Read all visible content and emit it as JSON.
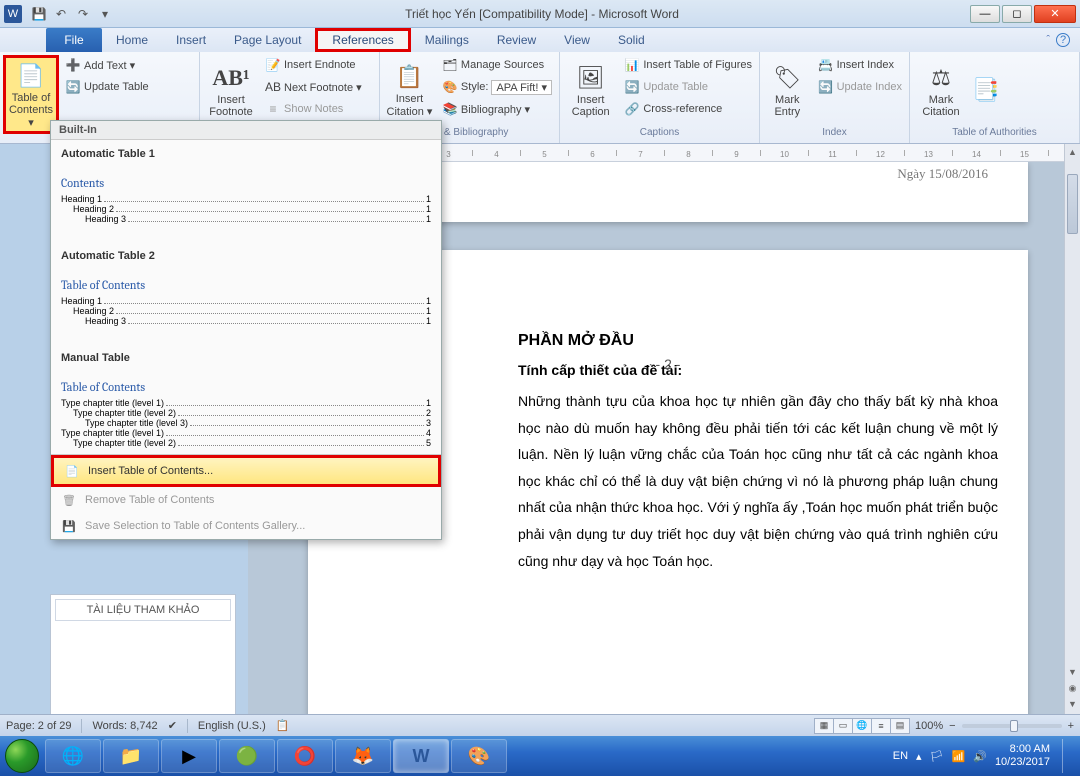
{
  "titlebar": {
    "app_icon_letter": "W",
    "title": "Triết học Yến [Compatibility Mode] - Microsoft Word"
  },
  "tabs": {
    "file": "File",
    "items": [
      "Home",
      "Insert",
      "Page Layout",
      "References",
      "Mailings",
      "Review",
      "View",
      "Solid"
    ],
    "active": "References"
  },
  "ribbon": {
    "toc": {
      "big": "Table of Contents ▾",
      "add_text": "Add Text ▾",
      "update": "Update Table"
    },
    "footnotes": {
      "big": "Insert Footnote",
      "ab": "AB¹",
      "endnote": "Insert Endnote",
      "next": "Next Footnote ▾",
      "show": "Show Notes",
      "label": ""
    },
    "citations": {
      "big": "Insert Citation ▾",
      "manage": "Manage Sources",
      "style_lbl": "Style:",
      "style_val": "APA Fift! ▾",
      "biblio": "Bibliography ▾",
      "label": "ns & Bibliography"
    },
    "captions": {
      "big": "Insert Caption",
      "figures": "Insert Table of Figures",
      "update": "Update Table",
      "cross": "Cross-reference",
      "label": "Captions"
    },
    "index": {
      "big": "Mark Entry",
      "insert": "Insert Index",
      "update": "Update Index",
      "label": "Index"
    },
    "authorities": {
      "big": "Mark Citation",
      "label": "Table of Authorities"
    }
  },
  "toc_panel": {
    "builtin": "Built-In",
    "auto1": {
      "title": "Automatic Table 1",
      "heading": "Contents",
      "h1": "Heading 1",
      "h2": "Heading 2",
      "h3": "Heading 3",
      "p": "1"
    },
    "auto2": {
      "title": "Automatic Table 2",
      "heading": "Table of Contents",
      "h1": "Heading 1",
      "h2": "Heading 2",
      "h3": "Heading 3",
      "p": "1"
    },
    "manual": {
      "title": "Manual Table",
      "heading": "Table of Contents",
      "l1": "Type chapter title (level 1)",
      "l2": "Type chapter title (level 2)",
      "l3": "Type chapter title (level 3)",
      "l4": "Type chapter title (level 1)",
      "l5": "Type chapter title (level 2)",
      "p1": "1",
      "p2": "2",
      "p3": "3",
      "p4": "4",
      "p5": "5"
    },
    "insert": "Insert Table of Contents...",
    "remove": "Remove Table of Contents",
    "save_sel": "Save Selection to Table of Contents Gallery..."
  },
  "navpane": {
    "item": "TÀI LIỆU THAM KHẢO"
  },
  "document": {
    "date": "Ngày 15/08/2016",
    "page_num": "- 2 -",
    "sec_title": "PHẦN  MỞ ĐẦU",
    "sub_title": "Tính cấp thiết của đề tài:",
    "body": "Những thành tựu của khoa học tự nhiên gần đây cho thấy bất kỳ nhà khoa học nào dù muốn hay không đều phải tiến tới các kết luận chung về một lý luận. Nền lý luận vững chắc của Toán học cũng như tất cả các ngành khoa học khác chỉ có thể là duy vật biện chứng vì nó là phương pháp luận chung nhất của nhận thức khoa học. Với ý nghĩa ấy ,Toán học muốn phát triển buộc phải vận dụng tư duy triết học  duy vật biện chứng vào quá trình nghiên cứu cũng như dạy và học Toán học."
  },
  "statusbar": {
    "page": "Page: 2 of 29",
    "words": "Words: 8,742",
    "lang": "English (U.S.)",
    "zoom": "100%"
  },
  "tray": {
    "lang": "EN",
    "time": "8:00 AM",
    "date": "10/23/2017"
  }
}
